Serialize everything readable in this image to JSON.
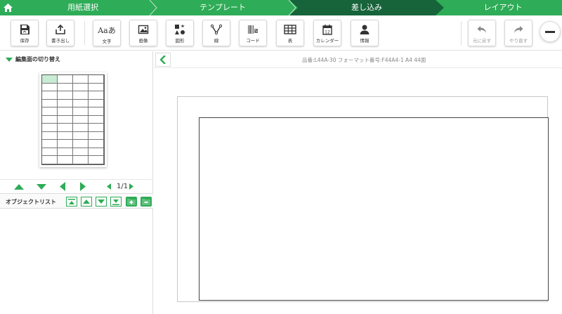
{
  "steps": {
    "home_icon": "home-icon",
    "items": [
      {
        "label": "用紙選択",
        "state": "done"
      },
      {
        "label": "テンプレート",
        "state": "done"
      },
      {
        "label": "差し込み",
        "state": "current"
      },
      {
        "label": "レイアウト",
        "state": "todo"
      }
    ]
  },
  "toolbar": {
    "save": "保存",
    "export": "書き出し",
    "text": "文字",
    "text_icon_glyph": "Aaあ",
    "image": "画像",
    "shape": "図形",
    "line": "線",
    "code": "コード",
    "table": "表",
    "calendar": "カレンダー",
    "info": "情報",
    "undo": "元に戻す",
    "redo": "やり直す"
  },
  "left_panel": {
    "switch_title": "編集面の切り替え",
    "page_count": "1/1",
    "object_list_title": "オブジェクトリスト"
  },
  "canvas": {
    "product_info": "品番:L44A-30 フォーマット番号:F44A4-1 A4 44面"
  },
  "colors": {
    "accent": "#2eac57",
    "accent_dark": "#17633a"
  }
}
